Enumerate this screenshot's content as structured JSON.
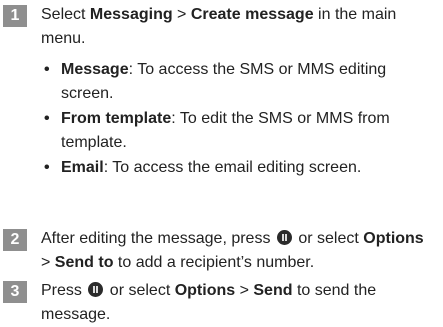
{
  "steps": [
    {
      "number": "1",
      "p1": "Select ",
      "b1": "Messaging",
      "p2": " > ",
      "b2": "Create message",
      "p3": " in the main menu.",
      "bullets": [
        {
          "term": "Message",
          "text": ": To access the SMS or MMS editing screen."
        },
        {
          "term": "From template",
          "text": ": To edit the SMS or MMS from template."
        },
        {
          "term": "Email",
          "text": ": To access the email editing screen."
        }
      ]
    },
    {
      "number": "2",
      "p1": "After editing the message, press ",
      "icon": "ok-key-icon",
      "p2": " or select ",
      "b1": "Options",
      "p3": " > ",
      "b2": "Send to",
      "p4": " to add a recipient’s number."
    },
    {
      "number": "3",
      "p1": "Press ",
      "icon": "ok-key-icon",
      "p2": " or select ",
      "b1": "Options",
      "p3": " > ",
      "b2": "Send",
      "p4": "  to send the message."
    }
  ]
}
